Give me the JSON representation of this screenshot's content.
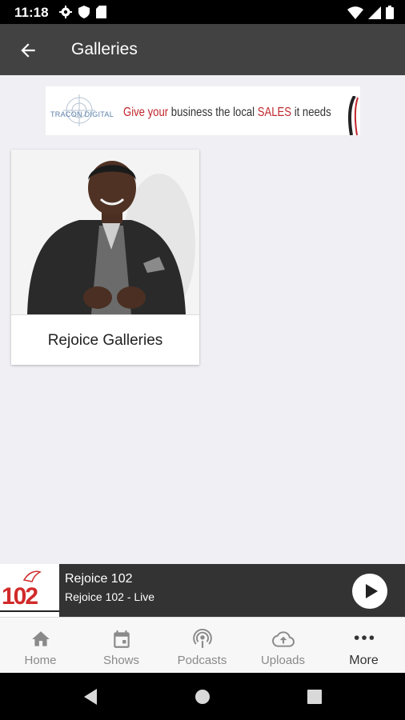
{
  "status_bar": {
    "time": "11:18",
    "icons_left": [
      "gear-icon",
      "shield-icon",
      "sd-card-icon"
    ],
    "icons_right": [
      "wifi-icon",
      "signal-icon",
      "battery-icon"
    ]
  },
  "app_bar": {
    "title": "Galleries",
    "back_icon": "arrow-left-icon"
  },
  "ad_banner": {
    "brand": "TRACON DIGITAL",
    "text_1": "Give your",
    "text_2": "business the local",
    "text_3": "SALES",
    "text_4": "it needs"
  },
  "galleries": [
    {
      "title": "Rejoice Galleries",
      "image": "man-in-suit-photo"
    }
  ],
  "player": {
    "logo_text": "102",
    "title": "Rejoice 102",
    "subtitle": "Rejoice 102 - Live",
    "play_icon": "play-icon"
  },
  "bottom_nav": {
    "items": [
      {
        "label": "Home",
        "icon": "home-icon"
      },
      {
        "label": "Shows",
        "icon": "calendar-icon"
      },
      {
        "label": "Podcasts",
        "icon": "podcast-icon"
      },
      {
        "label": "Uploads",
        "icon": "cloud-upload-icon"
      },
      {
        "label": "More",
        "icon": "more-dots-icon"
      }
    ],
    "active_index": 4
  },
  "colors": {
    "app_bar": "#424242",
    "background": "#efeff4",
    "player_bar": "#333333",
    "ad_red": "#c0272d"
  }
}
